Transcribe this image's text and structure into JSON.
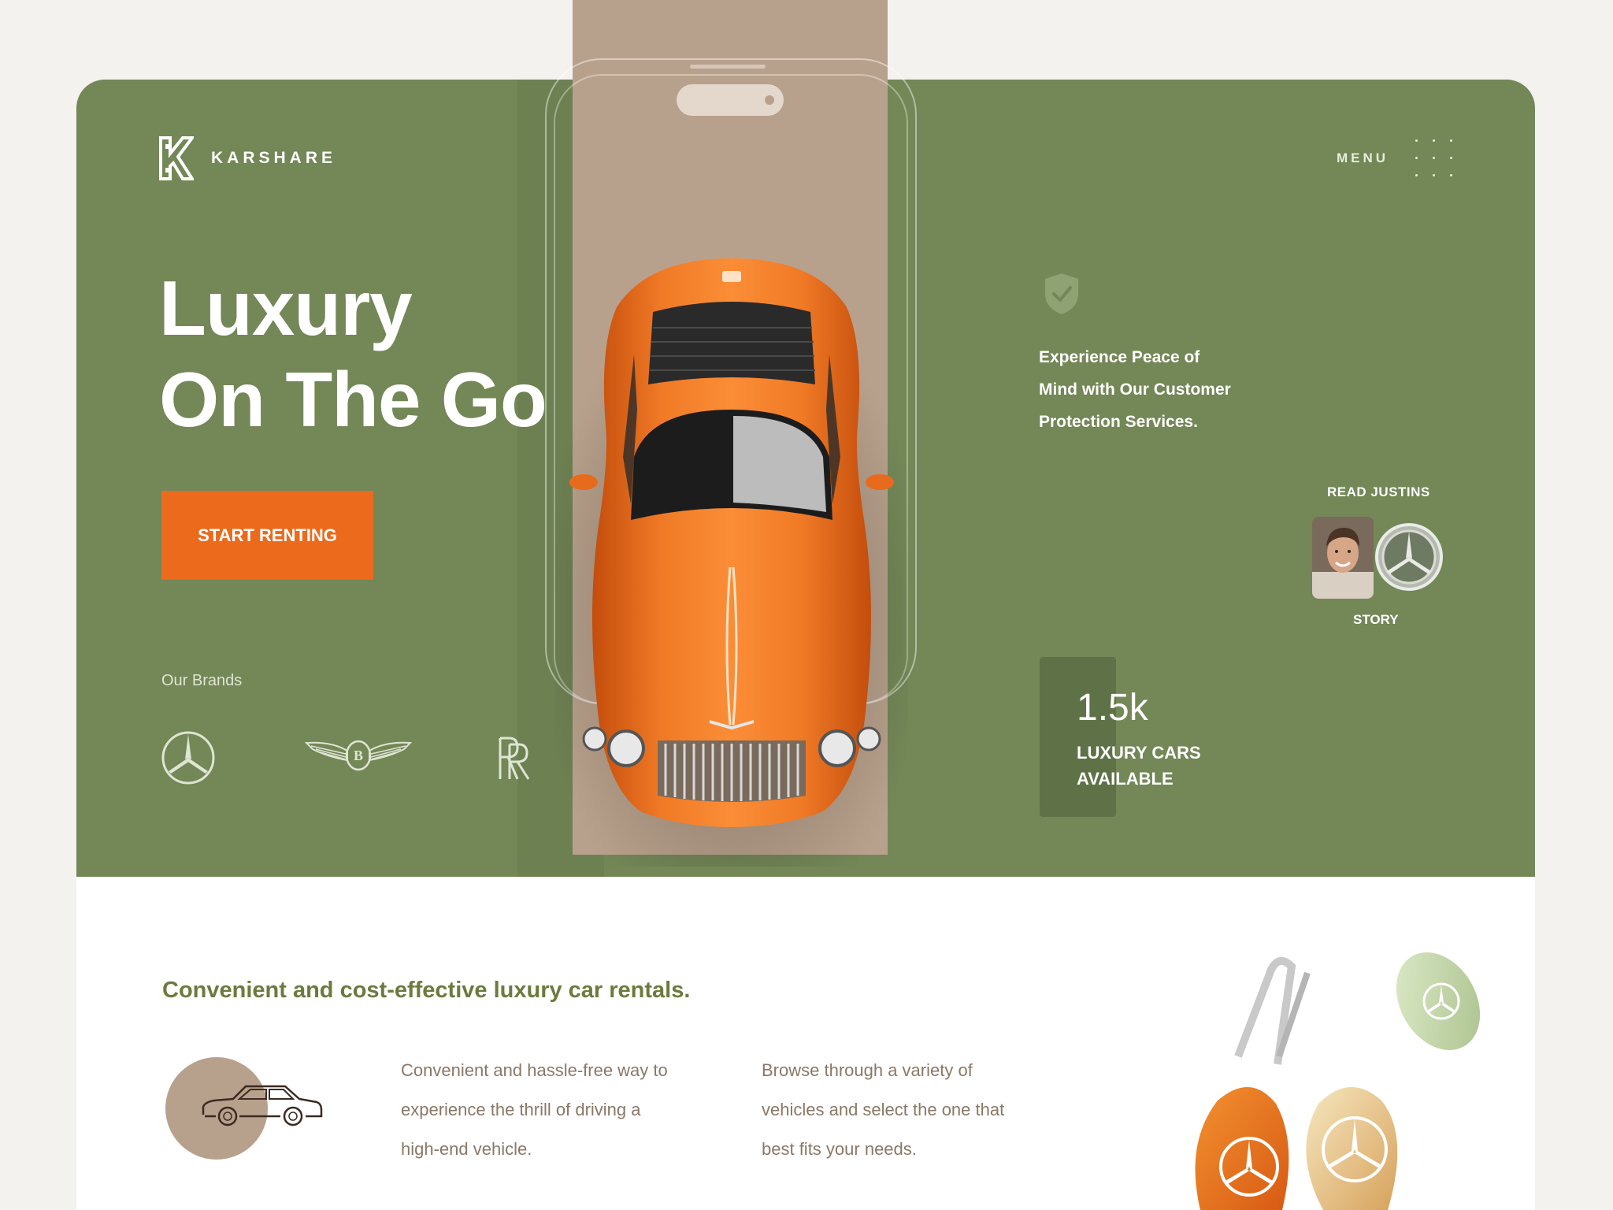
{
  "brand": {
    "name": "KARSHARE"
  },
  "nav": {
    "menu_label": "MENU"
  },
  "hero": {
    "headline_line1": "Luxury",
    "headline_line2": "On The Go",
    "cta_label": "START RENTING",
    "brands_label": "Our Brands",
    "brands": [
      "mercedes-benz-logo",
      "bentley-logo",
      "rolls-royce-logo"
    ]
  },
  "protection": {
    "line1": "Experience Peace of",
    "line2": "Mind with Our Customer",
    "line3": "Protection Services."
  },
  "story": {
    "top": "READ JUSTINS",
    "bottom": "STORY"
  },
  "stat": {
    "value": "1.5k",
    "label_line1": "LUXURY CARS",
    "label_line2": "AVAILABLE"
  },
  "section": {
    "title": "Convenient and cost-effective luxury car rentals.",
    "col1_line1": "Convenient and hassle-free way to",
    "col1_line2": "experience the thrill of driving a",
    "col1_line3": "high-end vehicle.",
    "col2_line1": "Browse through a variety of",
    "col2_line2": "vehicles and select the one that",
    "col2_line3": "best fits your needs."
  },
  "colors": {
    "background": "#f4f2ef",
    "hero_green": "#738757",
    "accent_orange": "#ec6a1c",
    "tan": "#b8a18c",
    "heading_green": "#6b7b3e",
    "body_brown": "#8a7866"
  }
}
